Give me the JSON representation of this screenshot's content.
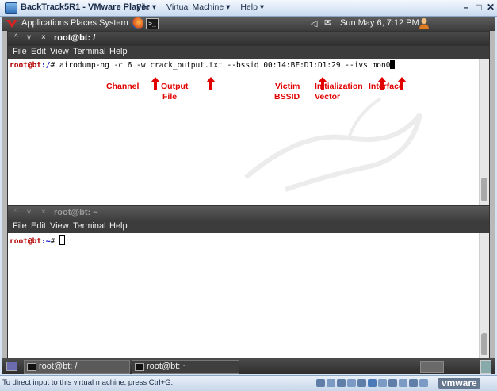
{
  "vm_window": {
    "title": "BackTrack5R1 - VMware Player",
    "menus": [
      "File ▾",
      "Virtual Machine ▾",
      "Help ▾"
    ],
    "status_text": "To direct input to this virtual machine, press Ctrl+G.",
    "brand": "vmware"
  },
  "top_panel": {
    "applications": "Applications",
    "places": "Places",
    "system": "System",
    "clock": "Sun May  6,  7:12 PM"
  },
  "terminal1": {
    "title": "root@bt: /",
    "menus": [
      "File",
      "Edit",
      "View",
      "Terminal",
      "Help"
    ],
    "prompt_user": "root@bt",
    "prompt_path": ":/",
    "command": "# airodump-ng -c 6 -w crack_output.txt --bssid 00:14:BF:D1:D1:29 --ivs mon0"
  },
  "annotations": {
    "channel": "Channel",
    "output_file_1": "Output",
    "output_file_2": "File",
    "victim_1": "Victim",
    "victim_2": "BSSID",
    "init_1": "Initialization",
    "init_2": "Vector",
    "interface": "Interface"
  },
  "terminal2": {
    "title": "root@bt: ~",
    "menus": [
      "File",
      "Edit",
      "View",
      "Terminal",
      "Help"
    ],
    "prompt_user": "root@bt",
    "prompt_path": ":~",
    "prompt_symbol": "# "
  },
  "taskbar": {
    "task1": "root@bt: /",
    "task2": "root@bt: ~"
  }
}
